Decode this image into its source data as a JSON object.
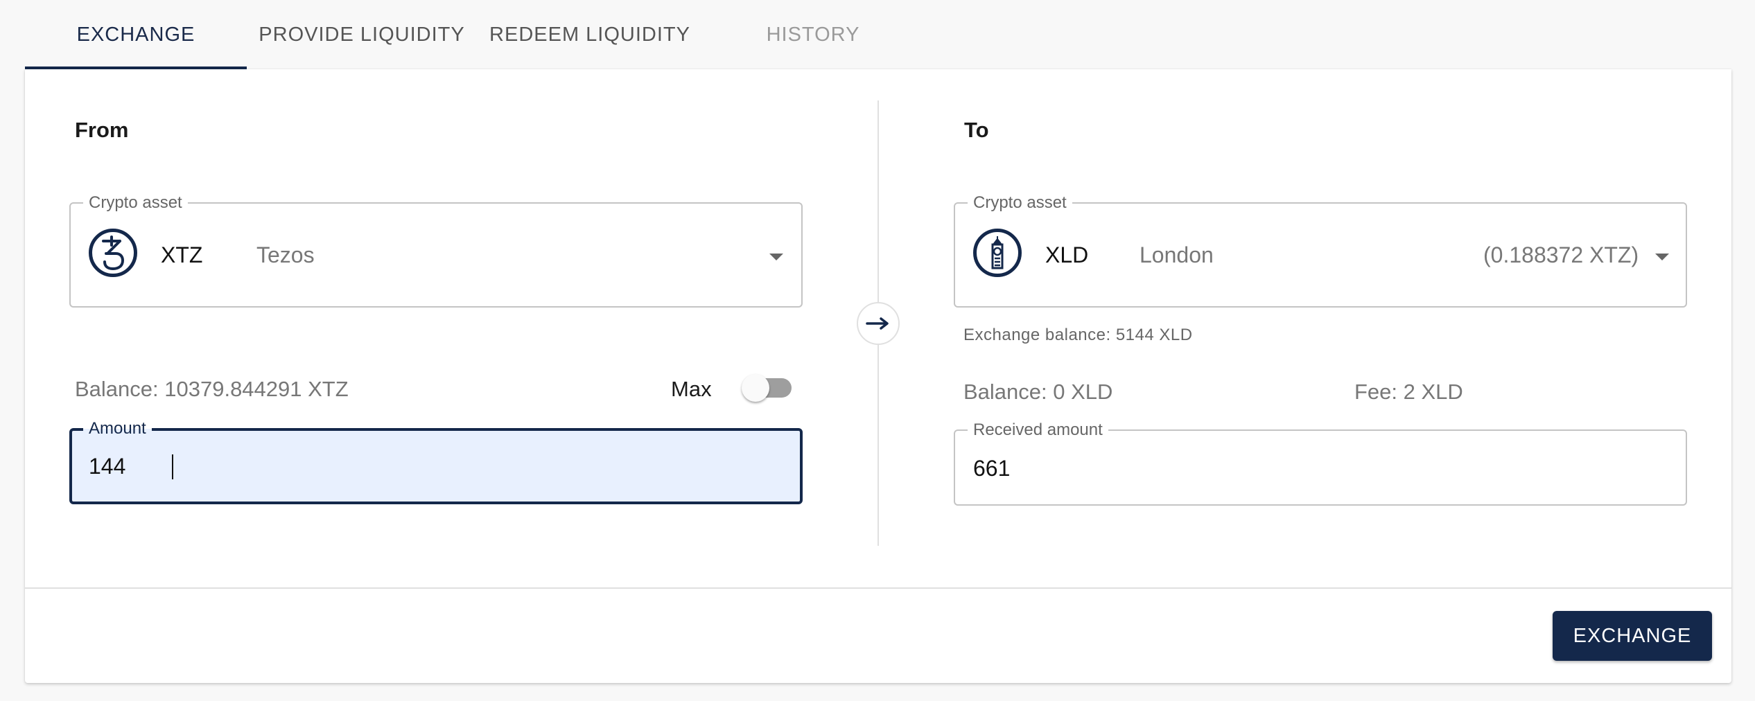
{
  "tabs": [
    {
      "label": "EXCHANGE",
      "state": "active"
    },
    {
      "label": "PROVIDE LIQUIDITY",
      "state": "normal"
    },
    {
      "label": "REDEEM LIQUIDITY",
      "state": "normal"
    },
    {
      "label": "HISTORY",
      "state": "disabled"
    }
  ],
  "from": {
    "title": "From",
    "asset_label": "Crypto asset",
    "asset_symbol": "XTZ",
    "asset_name": "Tezos",
    "asset_icon": "tezos-icon",
    "balance": "Balance: 10379.844291 XTZ",
    "max_label": "Max",
    "max_enabled": false,
    "amount_label": "Amount",
    "amount_value": "144"
  },
  "to": {
    "title": "To",
    "asset_label": "Crypto asset",
    "asset_symbol": "XLD",
    "asset_name": "London",
    "asset_rate": "(0.188372 XTZ)",
    "asset_icon": "big-ben-icon",
    "exchange_balance": "Exchange balance: 5144 XLD",
    "balance": "Balance: 0 XLD",
    "fee": "Fee: 2 XLD",
    "received_label": "Received amount",
    "received_value": "661"
  },
  "actions": {
    "exchange_label": "EXCHANGE",
    "swap_icon": "arrow-right-icon"
  },
  "colors": {
    "primary": "#14284b",
    "input_focus_bg": "#e8f0fe",
    "page_bg": "#f8f8f8"
  }
}
